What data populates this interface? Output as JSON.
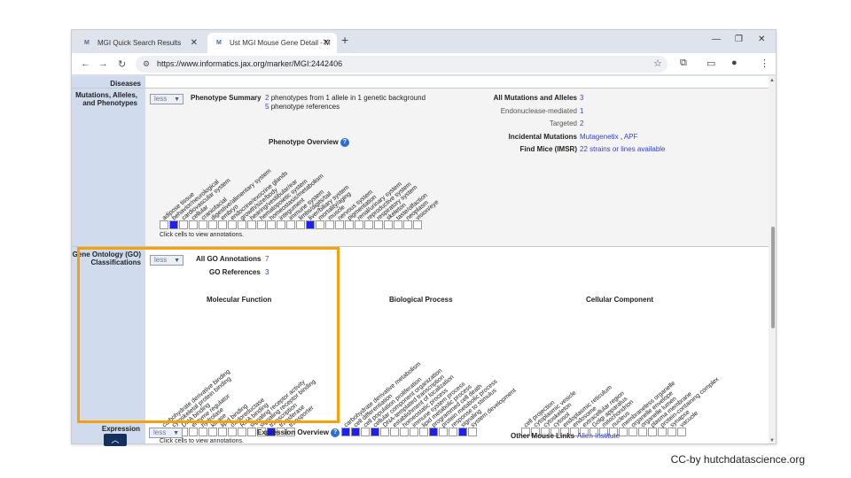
{
  "browser": {
    "tabs": [
      {
        "title": "MGI Quick Search Results",
        "active": false
      },
      {
        "title": "Ust MGI Mouse Gene Detail - M",
        "active": true
      }
    ],
    "url": "https://www.informatics.jax.org/marker/MGI:2442406"
  },
  "page": {
    "sections": {
      "diseases_label": "Diseases",
      "mutations_label": "Mutations, Alleles, and Phenotypes",
      "go_label": "Gene Ontology (GO) Classifications",
      "expression_label": "Expression"
    },
    "less_label": "less",
    "phenotype": {
      "summary_label": "Phenotype Summary",
      "count1": "2",
      "text1": "phenotypes from 1 allele in 1 genetic background",
      "count2": "5",
      "text2": "phenotype references",
      "overview_title": "Phenotype Overview",
      "systems": [
        "adipose tissue",
        "behavior/neurological",
        "cardiovascular system",
        "cellular",
        "craniofacial",
        "digestive/alimentary system",
        "embryo",
        "endocrine/exocrine glands",
        "growth/size/body",
        "hearing/vestibular/ear",
        "hematopoietic system",
        "homeostasis/metabolism",
        "integument",
        "immune system",
        "limbs/digits/tail",
        "liver/biliary system",
        "mortality/aging",
        "muscle",
        "nervous system",
        "pigmentation",
        "renal/urinary system",
        "reproductive system",
        "respiratory system",
        "skeleton",
        "taste/olfaction",
        "neoplasm",
        "vision/eye"
      ],
      "filled": [
        false,
        true,
        false,
        false,
        false,
        false,
        false,
        false,
        false,
        false,
        false,
        false,
        false,
        false,
        false,
        true,
        false,
        false,
        false,
        false,
        false,
        false,
        false,
        false,
        false,
        false,
        false
      ],
      "click_note": "Click cells to view annotations."
    },
    "mutations": {
      "all_label": "All Mutations and Alleles",
      "all_value": "3",
      "endo_label": "Endonuclease-mediated",
      "endo_value": "1",
      "targeted_label": "Targeted",
      "targeted_value": "2",
      "incidental_label": "Incidental Mutations",
      "incidental_link1": "Mutagenetix",
      "incidental_sep": ",",
      "incidental_link2": "APF",
      "findmice_label": "Find Mice (IMSR)",
      "findmice_value": "22 strains or lines available"
    },
    "go": {
      "all_label": "All GO Annotations",
      "all_value": "7",
      "refs_label": "GO References",
      "refs_value": "3",
      "mf_title": "Molecular Function",
      "bp_title": "Biological Process",
      "cc_title": "Cellular Component",
      "mf_terms": [
        "carbohydrate derivative binding",
        "cytoskeletal protein binding",
        "DNA binding",
        "enzyme regulator",
        "hydrolase",
        "kinase",
        "lipid binding",
        "oxidoreductase",
        "RNA binding",
        "signaling receptor activity",
        "signaling receptor binding",
        "transcription",
        "transferase",
        "transporter"
      ],
      "mf_filled": [
        true,
        false,
        false,
        false,
        false,
        false,
        false,
        false,
        false,
        false,
        false,
        true,
        false,
        false
      ],
      "bp_terms": [
        "carbohydrate derivative metabolism",
        "cell differentiation",
        "cell population proliferation",
        "cellular component organization",
        "DNA-templated transcription",
        "establishment of localization",
        "homeostatic process",
        "immune system process",
        "lipid metabolic process",
        "programmed cell death",
        "protein metabolic process",
        "response to stimulus",
        "signaling",
        "system development"
      ],
      "bp_filled": [
        true,
        true,
        false,
        true,
        false,
        false,
        false,
        false,
        false,
        true,
        false,
        false,
        true,
        false
      ],
      "cc_terms": [
        "cell projection",
        "cytoplasmic vesicle",
        "cytoskeleton",
        "cytosol",
        "endoplasmic reticulum",
        "endosome",
        "extracellular region",
        "Golgi apparatus",
        "mitochondrion",
        "nucleus",
        "membraneless organelle",
        "organelle envelope",
        "organelle lumen",
        "plasma membrane",
        "protein-containing complex",
        "synapse",
        "vacuole"
      ],
      "cc_filled": [
        false,
        false,
        false,
        false,
        false,
        false,
        false,
        false,
        false,
        false,
        false,
        false,
        false,
        false,
        false,
        false
      ],
      "click_note": "Click cells to view annotations."
    },
    "expression": {
      "overview_title": "Expression Overview",
      "other_links_label": "Other Mouse Links",
      "other_links_value": "Allen Institute"
    }
  },
  "credit": "CC-by hutchdatascience.org",
  "colors": {
    "highlight": "#f5a00d",
    "filled_cell": "#1f1ff0",
    "label_column": "#d0dcee",
    "link": "#3344cc"
  }
}
